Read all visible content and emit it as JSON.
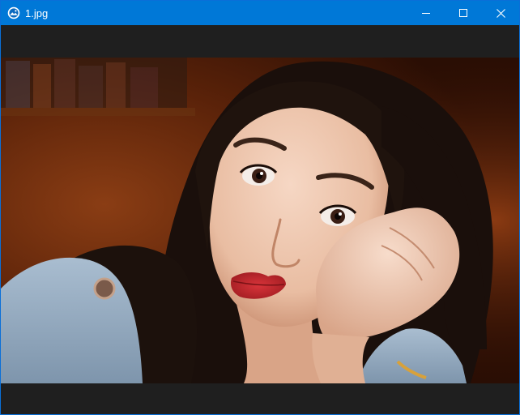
{
  "window": {
    "title": "1.jpg",
    "controls": {
      "minimize": "minimize",
      "maximize": "maximize",
      "close": "close"
    }
  },
  "image": {
    "icon": "photo-viewer-icon"
  },
  "colors": {
    "titlebar": "#0078d7",
    "background": "#1f1f1f"
  }
}
